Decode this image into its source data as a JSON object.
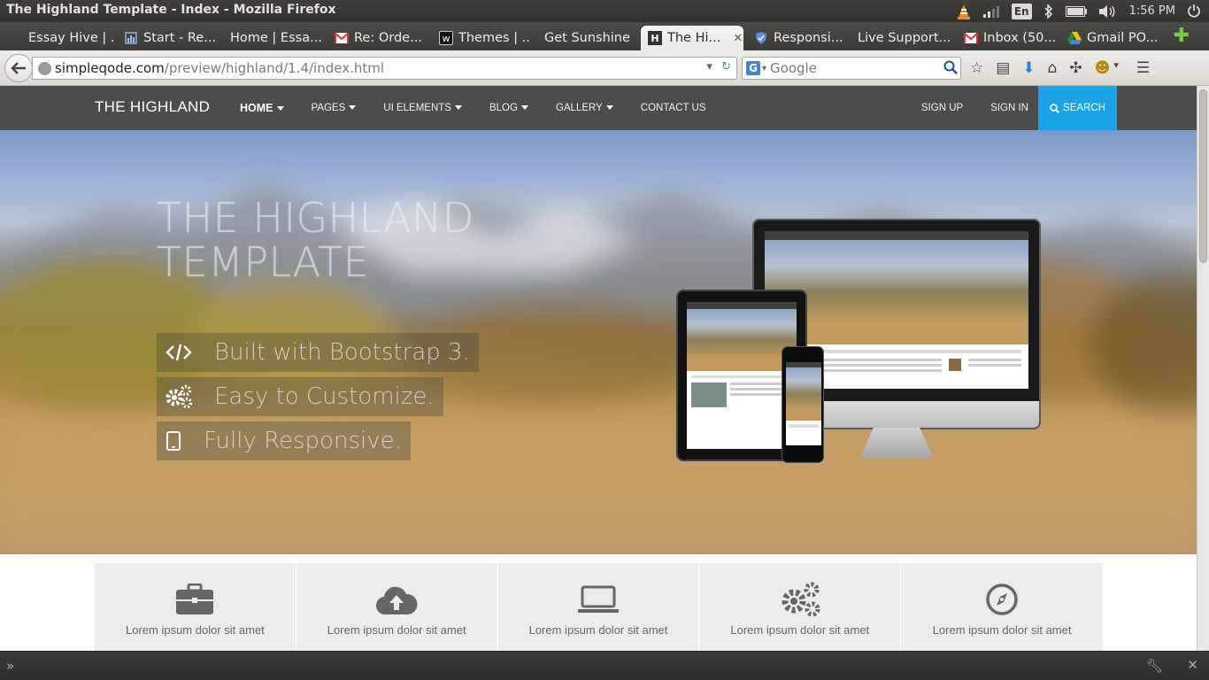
{
  "window": {
    "title": "The Highland Template - Index - Mozilla Firefox",
    "tray": {
      "language": "En",
      "time": "1:56 PM"
    }
  },
  "tabs": [
    {
      "label": "Essay Hive | ...",
      "favicon": "blank-icon"
    },
    {
      "label": "Start - Re...",
      "favicon": "chart-icon"
    },
    {
      "label": "Home | Essa...",
      "favicon": "blank-icon"
    },
    {
      "label": "Re: Orde...",
      "favicon": "gmail-icon"
    },
    {
      "label": "Themes | ...",
      "favicon": "w-icon"
    },
    {
      "label": "Get Sunshine",
      "favicon": "blank-icon"
    },
    {
      "label": "The Hi...",
      "favicon": "highland-icon",
      "active": true
    },
    {
      "label": "Responsi...",
      "favicon": "shield-icon"
    },
    {
      "label": "Live Support...",
      "favicon": "blank-icon"
    },
    {
      "label": "Inbox (50...",
      "favicon": "gmail-icon"
    },
    {
      "label": "Gmail PO...",
      "favicon": "drive-icon"
    }
  ],
  "address": {
    "host": "simpleqode.com",
    "path": "/preview/highland/1.4/index.html"
  },
  "search": {
    "engine": "G",
    "placeholder": "Google"
  },
  "site": {
    "brand": "THE HIGHLAND",
    "menu": [
      {
        "label": "HOME",
        "caret": true
      },
      {
        "label": "PAGES",
        "caret": true
      },
      {
        "label": "UI ELEMENTS",
        "caret": true
      },
      {
        "label": "BLOG",
        "caret": true
      },
      {
        "label": "GALLERY",
        "caret": true
      },
      {
        "label": "CONTACT US",
        "caret": false
      }
    ],
    "signup": "SIGN UP",
    "signin": "SIGN IN",
    "search_button": "SEARCH",
    "accent_color": "#1aa3e8"
  },
  "hero": {
    "title_line1": "THE HIGHLAND",
    "title_line2": "TEMPLATE",
    "features": [
      {
        "icon": "code-icon",
        "text": "Built with Bootstrap 3."
      },
      {
        "icon": "gears-icon",
        "text": "Easy to Customize."
      },
      {
        "icon": "mobile-icon",
        "text": "Fully Responsive."
      }
    ]
  },
  "feature_boxes": [
    {
      "icon": "briefcase-icon",
      "text": "Lorem ipsum dolor sit amet"
    },
    {
      "icon": "cloud-upload-icon",
      "text": "Lorem ipsum dolor sit amet"
    },
    {
      "icon": "laptop-icon",
      "text": "Lorem ipsum dolor sit amet"
    },
    {
      "icon": "gears-icon",
      "text": "Lorem ipsum dolor sit amet"
    },
    {
      "icon": "compass-icon",
      "text": "Lorem ipsum dolor sit amet"
    }
  ]
}
